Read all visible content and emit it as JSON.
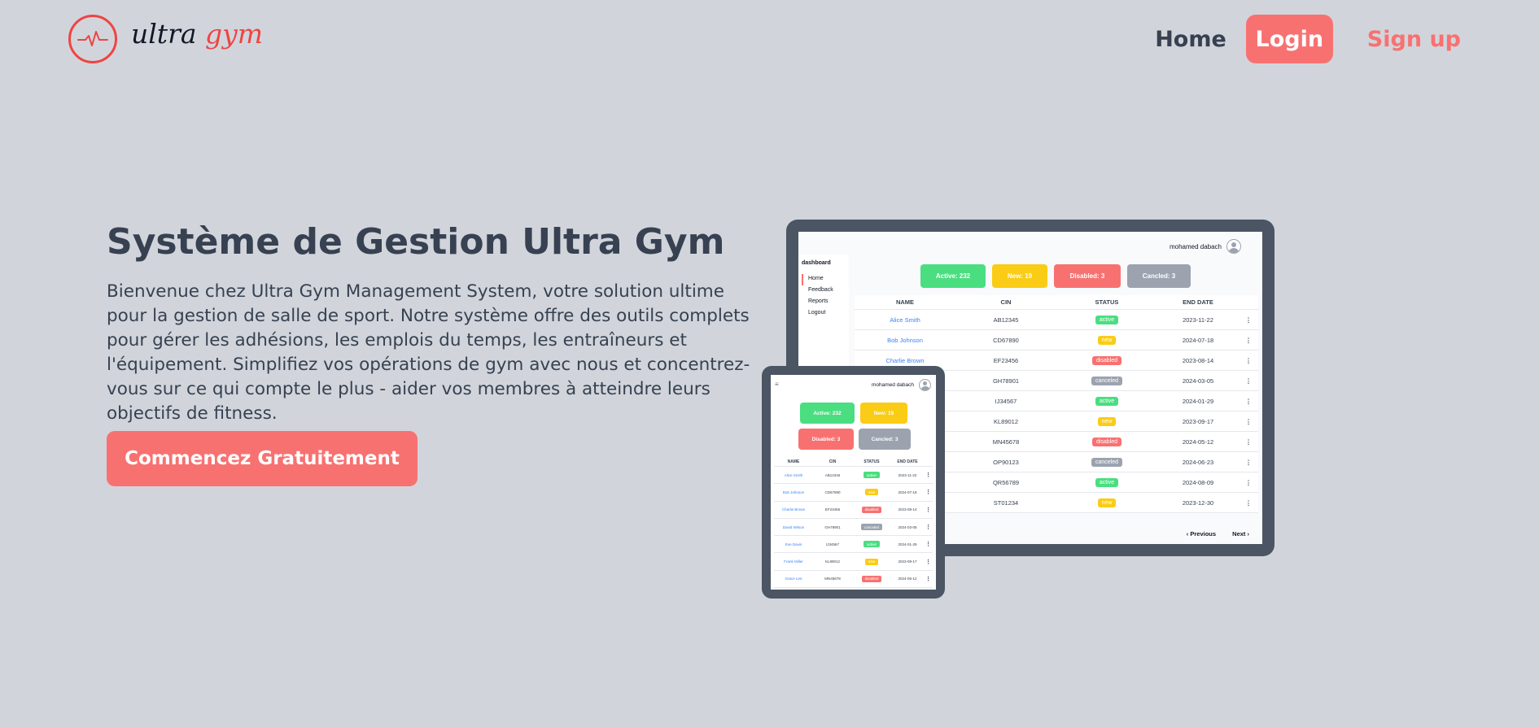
{
  "brand": {
    "name_part1": "ultra",
    "name_part2": "gym",
    "colors": {
      "accent": "#f87171",
      "logo": "#ef4444"
    },
    "icon": "heartbeat-icon"
  },
  "nav": {
    "home": "Home",
    "login": "Login",
    "signup": "Sign up"
  },
  "hero": {
    "title": "Système de Gestion Ultra Gym",
    "description": "Bienvenue chez Ultra Gym Management System, votre solution ultime pour la gestion de salle de sport. Notre système offre des outils complets pour gérer les adhésions, les emplois du temps, les entraîneurs et l'équipement. Simplifiez vos opérations de gym avec nous et concentrez-vous sur ce qui compte le plus - aider vos membres à atteindre leurs objectifs de fitness.",
    "cta": "Commencez Gratuitement"
  },
  "dashboard": {
    "user": "mohamed dabach",
    "sidebar_title": "dashboard",
    "sidebar": [
      "Home",
      "Feedback",
      "Reports",
      "Logout"
    ],
    "stats": {
      "active": "Active: 232",
      "new": "New: 19",
      "disabled": "Disabled: 3",
      "canceled": "Cancled: 3"
    },
    "columns": [
      "NAME",
      "CIN",
      "STATUS",
      "END DATE"
    ],
    "rows": [
      {
        "name": "Alice Smith",
        "cin": "AB12345",
        "status": "active",
        "end": "2023-11-22"
      },
      {
        "name": "Bob Johnson",
        "cin": "CD67890",
        "status": "new",
        "end": "2024-07-18"
      },
      {
        "name": "Charlie Brown",
        "cin": "EF23456",
        "status": "disabled",
        "end": "2023-08-14"
      },
      {
        "name": "",
        "cin": "GH78901",
        "status": "canceled",
        "end": "2024-03-05"
      },
      {
        "name": "",
        "cin": "IJ34567",
        "status": "active",
        "end": "2024-01-29"
      },
      {
        "name": "",
        "cin": "KL89012",
        "status": "new",
        "end": "2023-09-17"
      },
      {
        "name": "",
        "cin": "MN45678",
        "status": "disabled",
        "end": "2024-05-12"
      },
      {
        "name": "",
        "cin": "OP90123",
        "status": "canceled",
        "end": "2024-06-23"
      },
      {
        "name": "",
        "cin": "QR56789",
        "status": "active",
        "end": "2024-08-09"
      },
      {
        "name": "",
        "cin": "ST01234",
        "status": "new",
        "end": "2023-12-30"
      }
    ],
    "more": "⋮",
    "prev": "‹ Previous",
    "next": "Next ›"
  },
  "tablet": {
    "menu_icon": "≡",
    "user": "mohamed dabach",
    "stats": {
      "active": "Active: 232",
      "new": "New: 19",
      "disabled": "Disabled: 3",
      "canceled": "Cancled: 3"
    },
    "columns": [
      "NAME",
      "CIN",
      "STATUS",
      "END DATE"
    ],
    "rows": [
      {
        "name": "Alice Smith",
        "cin": "AB12345",
        "status": "active",
        "end": "2023-11-22"
      },
      {
        "name": "Bob Johnson",
        "cin": "CD67890",
        "status": "new",
        "end": "2024-07-18"
      },
      {
        "name": "Charlie Brown",
        "cin": "EF23456",
        "status": "disabled",
        "end": "2023-08-14"
      },
      {
        "name": "David Wilson",
        "cin": "GH78901",
        "status": "canceled",
        "end": "2024-03-05"
      },
      {
        "name": "Eve Davis",
        "cin": "IJ34567",
        "status": "active",
        "end": "2024-01-29"
      },
      {
        "name": "Frank Miller",
        "cin": "KL89012",
        "status": "new",
        "end": "2023-09-17"
      },
      {
        "name": "Grace Lee",
        "cin": "MN45678",
        "status": "disabled",
        "end": "2024-05-12"
      }
    ],
    "more": "⋮"
  }
}
